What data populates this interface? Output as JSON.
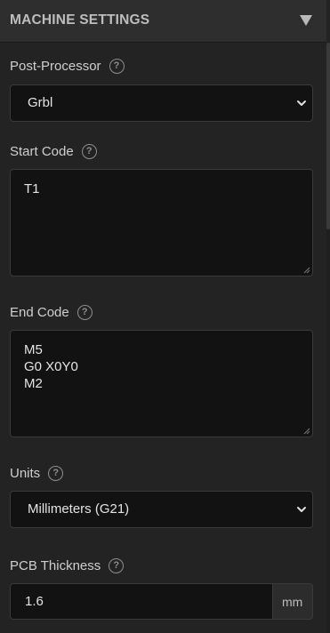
{
  "header": {
    "title": "MACHINE SETTINGS",
    "collapse_icon": "triangle-down-icon"
  },
  "post_processor": {
    "label": "Post-Processor",
    "help_icon": "question-circle-icon",
    "selected": "Grbl"
  },
  "start_code": {
    "label": "Start Code",
    "help_icon": "question-circle-icon",
    "lines": [
      "T1"
    ]
  },
  "end_code": {
    "label": "End Code",
    "help_icon": "question-circle-icon",
    "lines": [
      "M5",
      "G0 X0Y0",
      "M2"
    ]
  },
  "units": {
    "label": "Units",
    "help_icon": "question-circle-icon",
    "selected": "Millimeters (G21)"
  },
  "pcb_thickness": {
    "label": "PCB Thickness",
    "help_icon": "question-circle-icon",
    "value": "1.6",
    "unit": "mm"
  },
  "help_glyph": "?"
}
